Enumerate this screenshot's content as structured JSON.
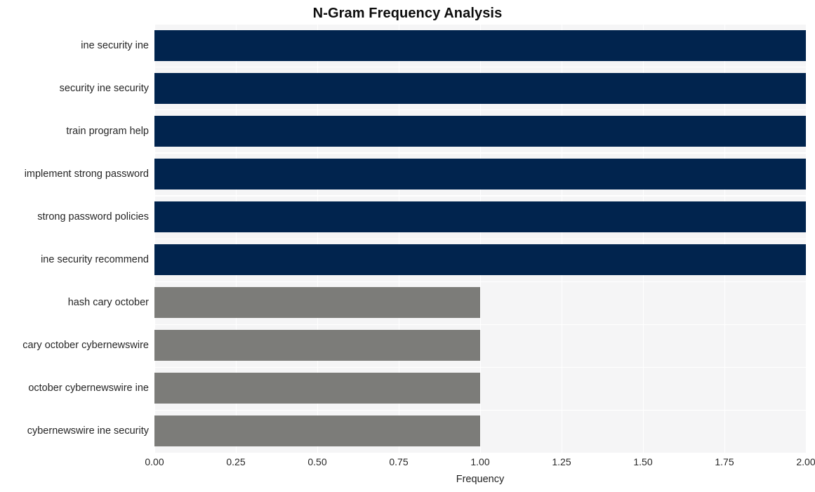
{
  "chart_data": {
    "type": "bar",
    "orientation": "horizontal",
    "title": "N-Gram Frequency Analysis",
    "xlabel": "Frequency",
    "ylabel": "",
    "categories": [
      "ine security ine",
      "security ine security",
      "train program help",
      "implement strong password",
      "strong password policies",
      "ine security recommend",
      "hash cary october",
      "cary october cybernewswire",
      "october cybernewswire ine",
      "cybernewswire ine security"
    ],
    "values": [
      2,
      2,
      2,
      2,
      2,
      2,
      1,
      1,
      1,
      1
    ],
    "bar_colors": [
      "#01244e",
      "#01244e",
      "#01244e",
      "#01244e",
      "#01244e",
      "#01244e",
      "#7c7c79",
      "#7c7c79",
      "#7c7c79",
      "#7c7c79"
    ],
    "xlim": [
      0.0,
      2.0
    ],
    "xticks": [
      0.0,
      0.25,
      0.5,
      0.75,
      1.0,
      1.25,
      1.5,
      1.75,
      2.0
    ],
    "xtick_labels": [
      "0.00",
      "0.25",
      "0.50",
      "0.75",
      "1.00",
      "1.25",
      "1.50",
      "1.75",
      "2.00"
    ],
    "grid": true,
    "legend": null,
    "plot_background": "#f5f5f6",
    "gridline_color": "#ffffff",
    "figure_background": "#ffffff"
  }
}
